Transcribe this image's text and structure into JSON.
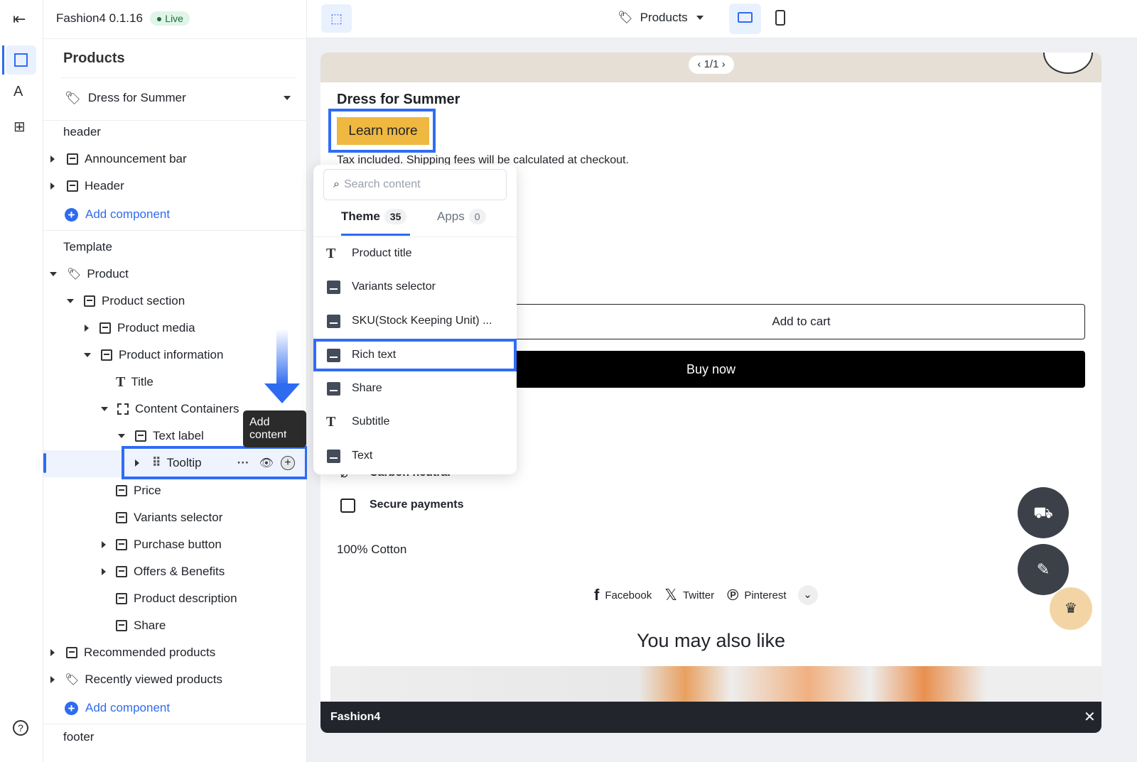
{
  "app": {
    "title": "Fashion4 0.1.16",
    "status": "Live"
  },
  "rail": {
    "icons": [
      "exit-icon",
      "layout-icon",
      "theme-style-icon",
      "add-app-icon",
      "help-icon"
    ]
  },
  "sidebar": {
    "title": "Products",
    "selector": "Dress for Summer",
    "header_group": "header",
    "header_items": [
      "Announcement bar",
      "Header"
    ],
    "add_component": "Add component",
    "template_group": "Template",
    "tree": {
      "product": "Product",
      "product_section": "Product section",
      "product_media": "Product media",
      "product_information": "Product information",
      "title": "Title",
      "content_containers": "Content Containers",
      "text_label": "Text label",
      "tooltip": "Tooltip",
      "price": "Price",
      "variants_selector": "Variants selector",
      "purchase_button": "Purchase button",
      "offers": "Offers & Benefits",
      "product_description": "Product description",
      "share": "Share",
      "recommended": "Recommended products",
      "recently_viewed": "Recently viewed products"
    },
    "footer_group": "footer",
    "tooltip_popup": "Add content"
  },
  "topbar": {
    "page_selector": "Products"
  },
  "popup": {
    "search_placeholder": "Search content",
    "tabs": [
      {
        "label": "Theme",
        "count": "35"
      },
      {
        "label": "Apps",
        "count": "0"
      }
    ],
    "items": [
      "Product title",
      "Variants selector",
      "SKU(Stock Keeping Unit) ...",
      "Rich text",
      "Share",
      "Subtitle",
      "Text"
    ]
  },
  "preview": {
    "pager": "1/1",
    "product_title": "Dress for Summer",
    "learn_more": "Learn more",
    "tax_note": "Tax included. Shipping fees will be calculated at checkout.",
    "add_to_cart": "Add to cart",
    "buy_now": "Buy now",
    "carbon": "Carbon neutral",
    "secure": "Secure payments",
    "material": "100% Cotton",
    "social": [
      "Facebook",
      "Twitter",
      "Pinterest"
    ],
    "also_like": "You may also like",
    "bottom_bar": "Fashion4"
  },
  "colors": {
    "accent": "#2e6bf0",
    "highlight": "#2f6cf6",
    "learn_more_bg": "#efb840",
    "live_bg": "#dff5e7"
  }
}
